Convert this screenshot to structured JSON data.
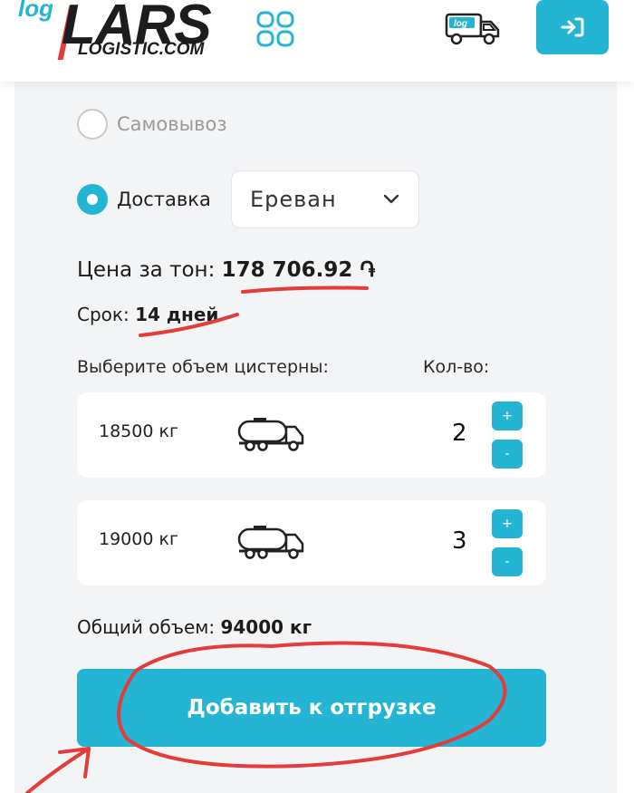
{
  "header": {
    "logo_log": "log",
    "logo_lars": "LARS",
    "logo_domain": "LOGISTIC.COM",
    "truck_tag": "log",
    "icons": [
      "grid-icon",
      "truck-icon",
      "login-icon"
    ]
  },
  "delivery": {
    "pickup_label": "Самовывоз",
    "pickup_selected": false,
    "delivery_label": "Доставка",
    "delivery_selected": true,
    "city_value": "Ереван"
  },
  "pricing": {
    "price_label": "Цена за тон:",
    "price_value": "178 706.92 ֏",
    "term_label": "Срок:",
    "term_value": "14 дней"
  },
  "tanks": {
    "volume_header": "Выберите объем цистерны:",
    "qty_header": "Кол-во:",
    "items": [
      {
        "weight": "18500 кг",
        "qty": "2",
        "plus": "+",
        "minus": "-"
      },
      {
        "weight": "19000 кг",
        "qty": "3",
        "plus": "+",
        "minus": "-"
      }
    ]
  },
  "summary": {
    "total_label": "Общий объем:",
    "total_value": "94000 кг",
    "add_button": "Добавить к отгрузке"
  },
  "colors": {
    "accent": "#23b5d3",
    "annotation": "#e43b3b",
    "panel": "#f3f4f6"
  }
}
